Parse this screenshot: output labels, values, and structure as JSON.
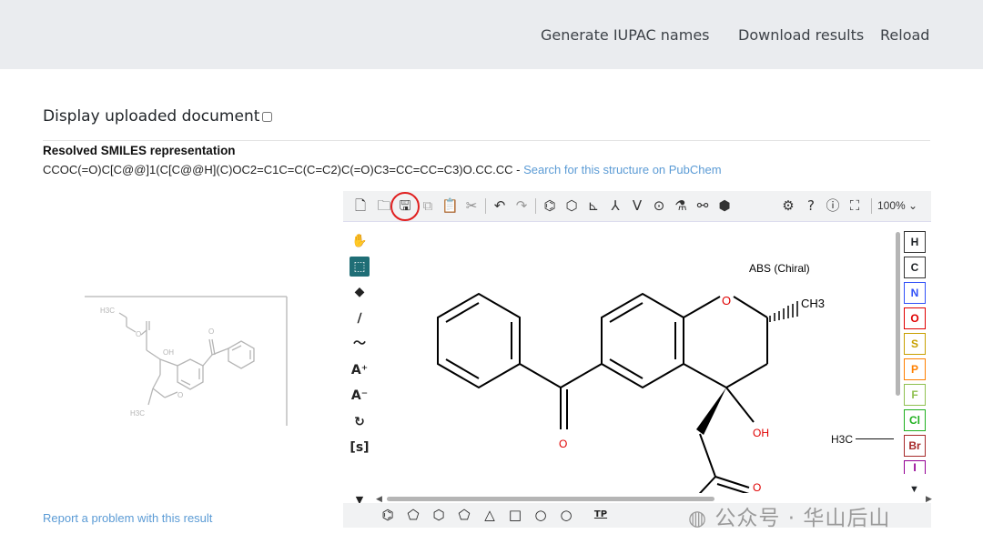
{
  "nav": {
    "generate": "Generate IUPAC names",
    "download": "Download results",
    "reload": "Reload"
  },
  "display_doc_label": "Display uploaded document",
  "smiles": {
    "title": "Resolved SMILES representation",
    "value": "CCOC(=O)C[C@@]1(C[C@@H](C)OC2=C1C=C(C=C2)C(=O)C3=CC=CC=C3)O.CC.CC",
    "separator": " - ",
    "link": "Search for this structure on PubChem"
  },
  "report_link": "Report a problem with this result",
  "editor": {
    "zoom": "100%",
    "chiral_label": "ABS (Chiral)",
    "atoms": [
      "H",
      "C",
      "N",
      "O",
      "S",
      "P",
      "F",
      "Cl",
      "Br",
      "I"
    ],
    "atom_colors": [
      "#000000",
      "#000000",
      "#3050f8",
      "#e00000",
      "#c8a000",
      "#ff8000",
      "#8fc050",
      "#1fb01f",
      "#a62929",
      "#940094"
    ],
    "mol_labels": {
      "o_ring": "O",
      "ch3": "CH3",
      "oh": "OH",
      "o_ketone": "O",
      "o_ester": "O"
    },
    "h3c": "H3C",
    "tp_label": "TP"
  },
  "thumb_labels": {
    "h3c_top": "H3C",
    "o": "O",
    "oh": "OH",
    "o2": "O",
    "o3": "O",
    "h3c_bottom": "H3C"
  },
  "watermark": "公众号 · 华山后山"
}
